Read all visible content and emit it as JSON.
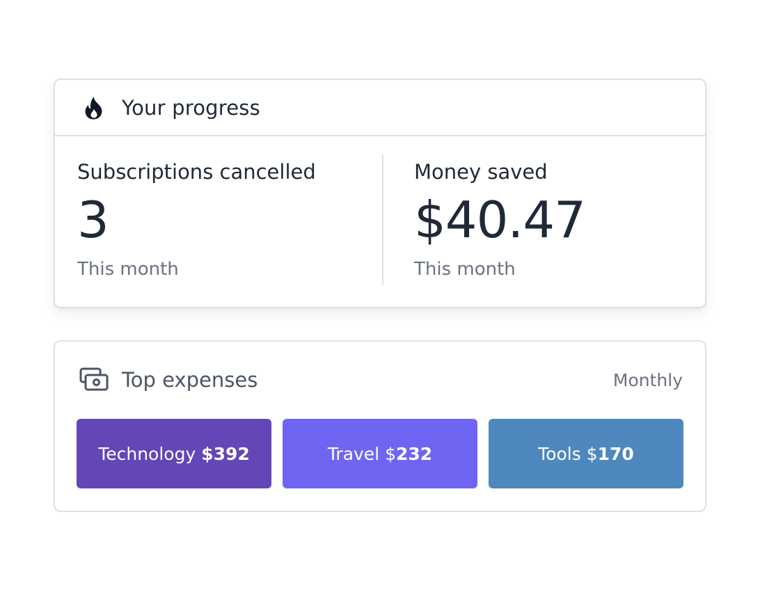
{
  "progress": {
    "title": "Your progress",
    "icon": "flame-icon",
    "stats": [
      {
        "label": "Subscriptions cancelled",
        "value": "3",
        "sub": "This month"
      },
      {
        "label": "Money saved",
        "value": "$40.47",
        "sub": "This month"
      }
    ]
  },
  "expenses": {
    "title": "Top expenses",
    "icon": "cash-icon",
    "period": "Monthly",
    "categories": [
      {
        "name": "Technology",
        "prefix": " ",
        "amount": "$392",
        "color": "#6546b6"
      },
      {
        "name": "Travel",
        "prefix": " $",
        "amount": "232",
        "color": "#6e65f3"
      },
      {
        "name": "Tools",
        "prefix": " $",
        "amount": "170",
        "color": "#4f88be"
      }
    ]
  },
  "colors": {
    "text_primary": "#1f2937",
    "text_muted": "#6b7280",
    "border": "#dde1e6"
  }
}
